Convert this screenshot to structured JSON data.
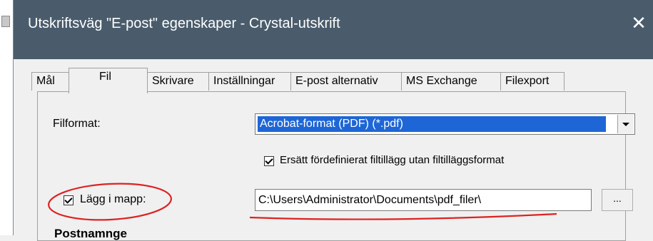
{
  "window": {
    "title": "Utskriftsväg \"E-post\" egenskaper - Crystal-utskrift",
    "close_icon": "close-icon"
  },
  "tabs": [
    {
      "label": "Mål"
    },
    {
      "label": "Fil"
    },
    {
      "label": "Skrivare"
    },
    {
      "label": "Inställningar"
    },
    {
      "label": "E-post alternativ"
    },
    {
      "label": "MS Exchange"
    },
    {
      "label": "Filexport"
    }
  ],
  "active_tab": "Fil",
  "fields": {
    "fileformat_label": "Filformat:",
    "fileformat_value": "Acrobat-format (PDF) (*.pdf)",
    "replace_ext_label": "Ersätt fördefinierat filtillägg utan filtilläggsformat",
    "replace_ext_checked": true,
    "folder_label": "Lägg i mapp:",
    "folder_checked": true,
    "folder_value": "C:\\Users\\Administrator\\Documents\\pdf_filer\\",
    "browse_label": "...",
    "next_heading": "Postnamnge"
  },
  "annotations": {
    "color": "#dd2222"
  }
}
